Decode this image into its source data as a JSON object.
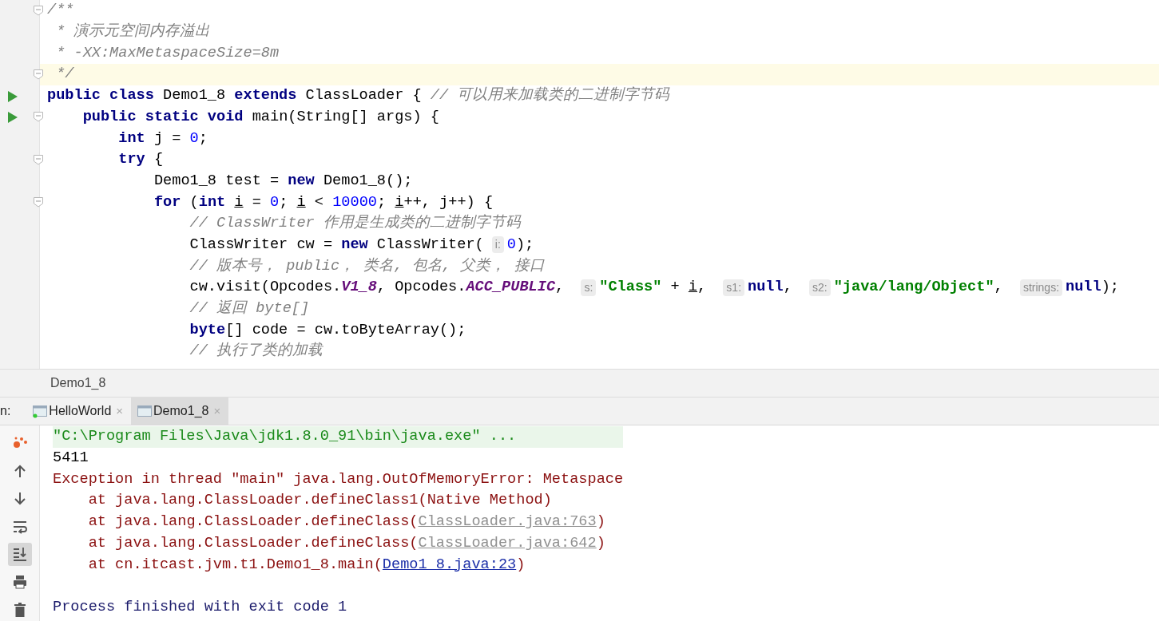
{
  "editor": {
    "lines": [
      {
        "run": false,
        "fold": true,
        "current": false,
        "tokens": [
          {
            "kind": "comment",
            "text": "/**"
          }
        ]
      },
      {
        "run": false,
        "fold": false,
        "current": false,
        "tokens": [
          {
            "kind": "comment",
            "text": " * 演示元空间内存溢出"
          }
        ]
      },
      {
        "run": false,
        "fold": false,
        "current": false,
        "tokens": [
          {
            "kind": "comment",
            "text": " * -XX:MaxMetaspaceSize=8m"
          }
        ]
      },
      {
        "run": false,
        "fold": true,
        "current": true,
        "tokens": [
          {
            "kind": "comment",
            "text": " */"
          }
        ]
      },
      {
        "run": true,
        "fold": false,
        "current": false,
        "tokens": [
          {
            "kind": "kw",
            "text": "public class "
          },
          {
            "kind": "plain",
            "text": "Demo1_8 "
          },
          {
            "kind": "kw",
            "text": "extends "
          },
          {
            "kind": "plain",
            "text": "ClassLoader { "
          },
          {
            "kind": "comment",
            "text": "// 可以用来加载类的二进制字节码"
          }
        ]
      },
      {
        "run": true,
        "fold": true,
        "current": false,
        "tokens": [
          {
            "kind": "kw",
            "text": "    public static void "
          },
          {
            "kind": "plain",
            "text": "main(String[] args) {"
          }
        ]
      },
      {
        "run": false,
        "fold": false,
        "current": false,
        "tokens": [
          {
            "kind": "kw",
            "text": "        int "
          },
          {
            "kind": "plain",
            "text": "j = "
          },
          {
            "kind": "num",
            "text": "0"
          },
          {
            "kind": "plain",
            "text": ";"
          }
        ]
      },
      {
        "run": false,
        "fold": true,
        "current": false,
        "tokens": [
          {
            "kind": "kw",
            "text": "        try "
          },
          {
            "kind": "plain",
            "text": "{"
          }
        ]
      },
      {
        "run": false,
        "fold": false,
        "current": false,
        "tokens": [
          {
            "kind": "plain",
            "text": "            Demo1_8 test = "
          },
          {
            "kind": "kw",
            "text": "new "
          },
          {
            "kind": "plain",
            "text": "Demo1_8();"
          }
        ]
      },
      {
        "run": false,
        "fold": true,
        "current": false,
        "tokens": [
          {
            "kind": "kw",
            "text": "            for "
          },
          {
            "kind": "plain",
            "text": "("
          },
          {
            "kind": "kw",
            "text": "int "
          },
          {
            "kind": "var",
            "text": "i"
          },
          {
            "kind": "plain",
            "text": " = "
          },
          {
            "kind": "num",
            "text": "0"
          },
          {
            "kind": "plain",
            "text": "; "
          },
          {
            "kind": "var",
            "text": "i"
          },
          {
            "kind": "plain",
            "text": " < "
          },
          {
            "kind": "num",
            "text": "10000"
          },
          {
            "kind": "plain",
            "text": "; "
          },
          {
            "kind": "var",
            "text": "i"
          },
          {
            "kind": "plain",
            "text": "++, j++) {"
          }
        ]
      },
      {
        "run": false,
        "fold": false,
        "current": false,
        "tokens": [
          {
            "kind": "comment",
            "text": "                // ClassWriter 作用是生成类的二进制字节码"
          }
        ]
      },
      {
        "run": false,
        "fold": false,
        "current": false,
        "tokens": [
          {
            "kind": "plain",
            "text": "                ClassWriter cw = "
          },
          {
            "kind": "kw",
            "text": "new "
          },
          {
            "kind": "plain",
            "text": "ClassWriter("
          },
          {
            "kind": "hint",
            "text": "i:"
          },
          {
            "kind": "num",
            "text": "0"
          },
          {
            "kind": "plain",
            "text": ");"
          }
        ]
      },
      {
        "run": false,
        "fold": false,
        "current": false,
        "tokens": [
          {
            "kind": "comment",
            "text": "                // 版本号， public， 类名, 包名, 父类， 接口"
          }
        ]
      },
      {
        "run": false,
        "fold": false,
        "current": false,
        "tokens": [
          {
            "kind": "plain",
            "text": "                cw.visit(Opcodes."
          },
          {
            "kind": "const",
            "text": "V1_8"
          },
          {
            "kind": "plain",
            "text": ", Opcodes."
          },
          {
            "kind": "const",
            "text": "ACC_PUBLIC"
          },
          {
            "kind": "plain",
            "text": ", "
          },
          {
            "kind": "hint",
            "text": "s:"
          },
          {
            "kind": "str",
            "text": "\"Class\""
          },
          {
            "kind": "plain",
            "text": " + "
          },
          {
            "kind": "var",
            "text": "i"
          },
          {
            "kind": "plain",
            "text": ", "
          },
          {
            "kind": "hint",
            "text": "s1:"
          },
          {
            "kind": "kw",
            "text": "null"
          },
          {
            "kind": "plain",
            "text": ", "
          },
          {
            "kind": "hint",
            "text": "s2:"
          },
          {
            "kind": "str",
            "text": "\"java/lang/Object\""
          },
          {
            "kind": "plain",
            "text": ", "
          },
          {
            "kind": "hint",
            "text": "strings:"
          },
          {
            "kind": "kw",
            "text": "null"
          },
          {
            "kind": "plain",
            "text": ");"
          }
        ]
      },
      {
        "run": false,
        "fold": false,
        "current": false,
        "tokens": [
          {
            "kind": "comment",
            "text": "                // 返回 byte[]"
          }
        ]
      },
      {
        "run": false,
        "fold": false,
        "current": false,
        "tokens": [
          {
            "kind": "kw",
            "text": "                byte"
          },
          {
            "kind": "plain",
            "text": "[] code = cw.toByteArray();"
          }
        ]
      },
      {
        "run": false,
        "fold": false,
        "current": false,
        "tokens": [
          {
            "kind": "comment",
            "text": "                // 执行了类的加载"
          }
        ]
      }
    ]
  },
  "breadcrumb": "Demo1_8",
  "run_panel": {
    "label": "n:",
    "tabs": [
      {
        "label": "HelloWorld",
        "selected": false,
        "close": "×"
      },
      {
        "label": "Demo1_8",
        "selected": true,
        "close": "×"
      }
    ],
    "tools": [
      {
        "kind": "rerun",
        "selected": false
      },
      {
        "kind": "up",
        "selected": false
      },
      {
        "kind": "down",
        "selected": false
      },
      {
        "kind": "wrap",
        "selected": false
      },
      {
        "kind": "scroll-end",
        "selected": true
      },
      {
        "kind": "print",
        "selected": false
      },
      {
        "kind": "trash",
        "selected": false
      }
    ],
    "console": [
      {
        "kind": "command",
        "parts": [
          {
            "kind": "text",
            "text": "\"C:\\Program Files\\Java\\jdk1.8.0_91\\bin\\java.exe\" ..."
          }
        ]
      },
      {
        "kind": "output",
        "parts": [
          {
            "kind": "text",
            "text": "5411"
          }
        ]
      },
      {
        "kind": "error",
        "parts": [
          {
            "kind": "text",
            "text": "Exception in thread \"main\" java.lang.OutOfMemoryError: Metaspace"
          }
        ]
      },
      {
        "kind": "error",
        "parts": [
          {
            "kind": "text",
            "text": "    at java.lang.ClassLoader.defineClass1(Native Method)"
          }
        ]
      },
      {
        "kind": "error",
        "parts": [
          {
            "kind": "text",
            "text": "    at java.lang.ClassLoader.defineClass("
          },
          {
            "kind": "lib-link",
            "text": "ClassLoader.java:763"
          },
          {
            "kind": "text",
            "text": ")"
          }
        ]
      },
      {
        "kind": "error",
        "parts": [
          {
            "kind": "text",
            "text": "    at java.lang.ClassLoader.defineClass("
          },
          {
            "kind": "lib-link",
            "text": "ClassLoader.java:642"
          },
          {
            "kind": "text",
            "text": ")"
          }
        ]
      },
      {
        "kind": "error",
        "parts": [
          {
            "kind": "text",
            "text": "    at cn.itcast.jvm.t1.Demo1_8.main("
          },
          {
            "kind": "src-link",
            "text": "Demo1_8.java:23"
          },
          {
            "kind": "text",
            "text": ")"
          }
        ]
      },
      {
        "kind": "blank"
      },
      {
        "kind": "info",
        "parts": [
          {
            "kind": "text",
            "text": "Process finished with exit code 1"
          }
        ]
      }
    ]
  }
}
